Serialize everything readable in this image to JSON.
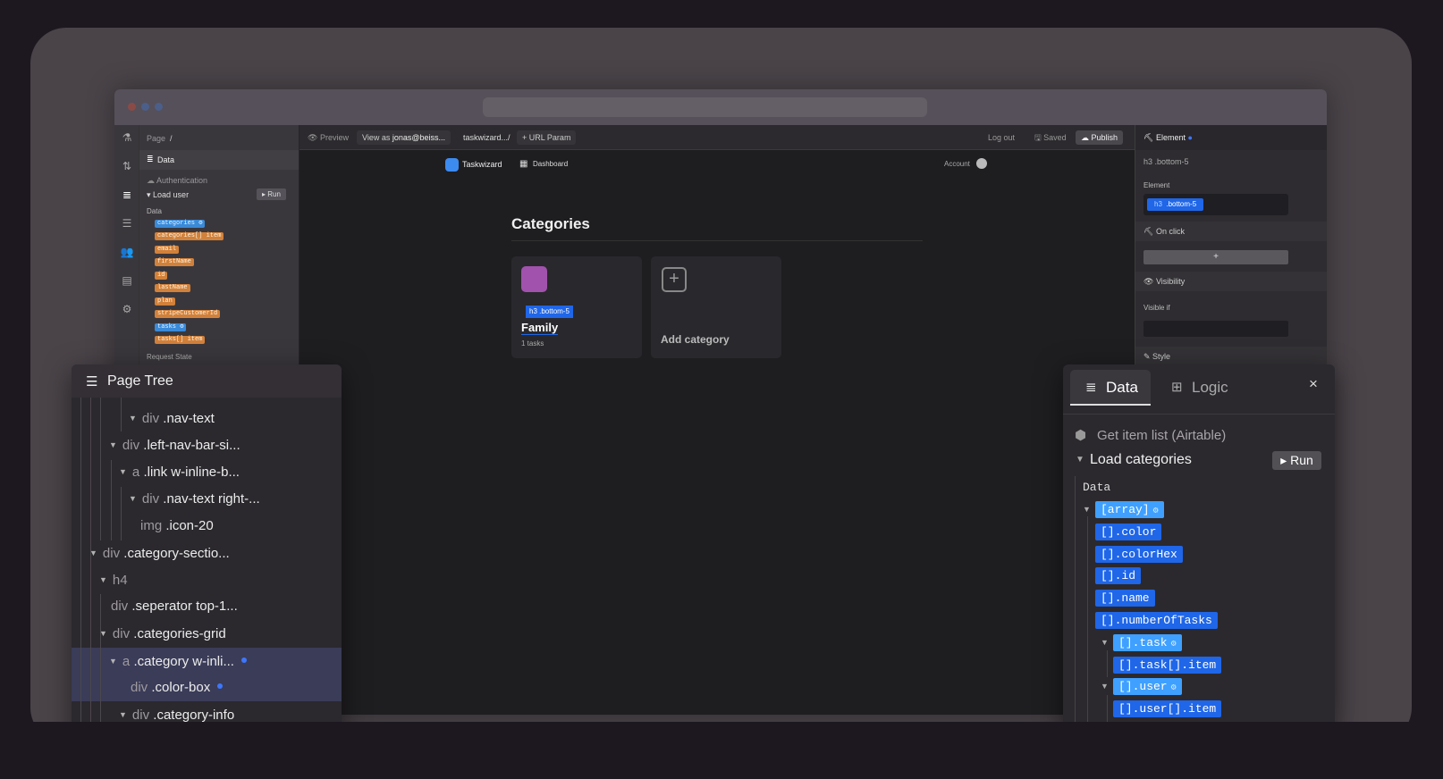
{
  "editor": {
    "left_panel": {
      "page_label": "Page",
      "page_path": "/",
      "section_title": "Data",
      "source_label": "Authentication",
      "query_label": "Load user",
      "run_label": "Run",
      "data_label": "Data",
      "tags": [
        "categories",
        "categories[] item",
        "email",
        "firstName",
        "id",
        "lastName",
        "plan",
        "stripeCustomerId",
        "tasks",
        "tasks[] item"
      ],
      "request_state": "Request State"
    },
    "topbar": {
      "preview": "Preview",
      "view_as_prefix": "View as",
      "view_as_user": "jonas@beiss...",
      "page_select": "taskwizard.../",
      "url_param": "+ URL Param",
      "logout": "Log out",
      "saved": "Saved",
      "publish": "Publish"
    },
    "app_nav": {
      "brand": "Taskwizard",
      "dashboard": "Dashboard",
      "account": "Account"
    },
    "canvas": {
      "title": "Categories",
      "card_badge": "h3 .bottom-5",
      "card_name": "Family",
      "card_tasks": "1 tasks",
      "add_label": "Add category"
    },
    "right_panel": {
      "header": "Element",
      "breadcrumb": "h3 .bottom-5",
      "element_label": "Element",
      "element_tag": "h3",
      "element_class": ".bottom-5",
      "on_click": "On click",
      "add_symbol": "+",
      "visibility": "Visibility",
      "visible_if": "Visible if",
      "style": "Style"
    }
  },
  "page_tree": {
    "title": "Page Tree",
    "rows": [
      {
        "tag": "div",
        "cls": ".nav-text"
      },
      {
        "tag": "div",
        "cls": ".left-nav-bar-si..."
      },
      {
        "tag": "a",
        "cls": ".link w-inline-b..."
      },
      {
        "tag": "div",
        "cls": ".nav-text right-..."
      },
      {
        "tag": "img",
        "cls": ".icon-20"
      },
      {
        "tag": "div",
        "cls": ".category-sectio..."
      },
      {
        "tag": "h4",
        "cls": ""
      },
      {
        "tag": "div",
        "cls": ".seperator top-1..."
      },
      {
        "tag": "div",
        "cls": ".categories-grid"
      },
      {
        "tag": "a",
        "cls": ".category w-inli..."
      },
      {
        "tag": "div",
        "cls": ".color-box"
      },
      {
        "tag": "div",
        "cls": ".category-info"
      }
    ]
  },
  "data_panel": {
    "tab_data": "Data",
    "tab_logic": "Logic",
    "close": "×",
    "source": "Get item list (Airtable)",
    "query": "Load categories",
    "run": "Run",
    "data_label": "Data",
    "fields": [
      "[array]",
      "[].color",
      "[].colorHex",
      "[].id",
      "[].name",
      "[].numberOfTasks",
      "[].task",
      "[].task[].item",
      "[].user",
      "[].user[].item"
    ]
  },
  "colors": {
    "accent_blue": "#1f66e8",
    "light_blue": "#3fa0ff",
    "tag_orange": "#d2813a",
    "swatch_purple": "#a052ad"
  }
}
